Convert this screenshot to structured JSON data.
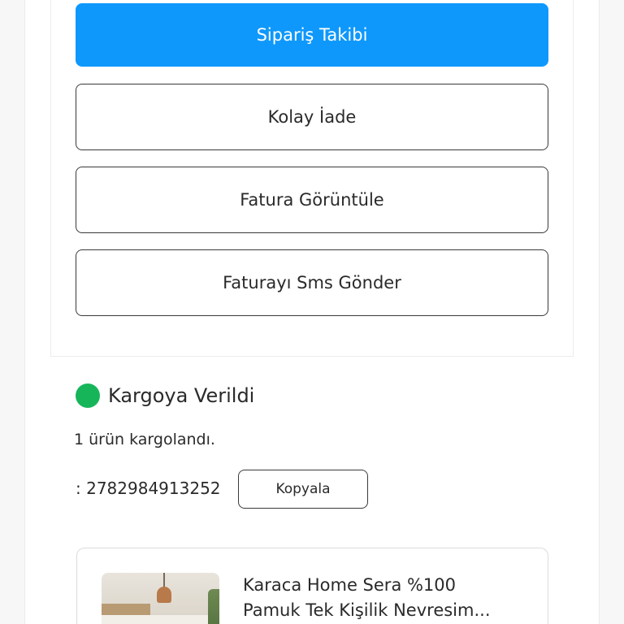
{
  "actions": {
    "order_tracking": "Sipariş Takibi",
    "easy_return": "Kolay İade",
    "view_invoice": "Fatura Görüntüle",
    "send_invoice_sms": "Faturayı Sms Gönder"
  },
  "shipment": {
    "status": "Kargoya Verildi",
    "status_color": "#17b55a",
    "summary": "1 ürün kargolandı.",
    "tracking_number": ": 2782984913252",
    "copy_label": "Kopyala"
  },
  "product": {
    "name_line1": "Karaca Home Sera %100",
    "name_line2": "Pamuk Tek Kişilik Nevresim..."
  },
  "colors": {
    "primary": "#0f98fb"
  }
}
